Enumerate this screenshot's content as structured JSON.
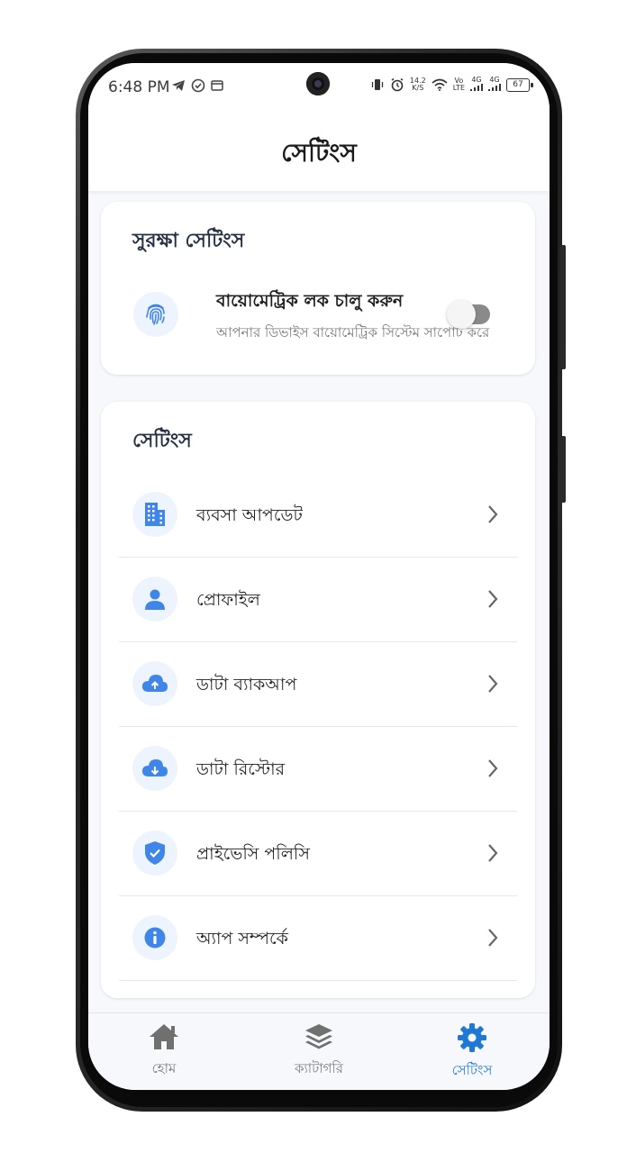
{
  "status_bar": {
    "time": "6:48 PM",
    "speed_top": "14.2",
    "speed_bottom": "K/S",
    "vo": "Vo",
    "lte": "LTE",
    "net1": "4G",
    "net2": "4G",
    "battery": "67"
  },
  "app_bar": {
    "title": "সেটিংস"
  },
  "security_card": {
    "title": "সুরক্ষা সেটিংস",
    "biometric": {
      "title": "বায়োমেট্রিক লক চালু করুন",
      "subtitle": "আপনার ডিভাইস বায়োমেট্রিক সিস্টেম সাপোর্ট করে",
      "enabled": false
    }
  },
  "settings_card": {
    "title": "সেটিংস",
    "items": [
      {
        "label": "ব্যবসা আপডেট",
        "icon": "building-icon"
      },
      {
        "label": "প্রোফাইল",
        "icon": "person-icon"
      },
      {
        "label": "ডাটা ব্যাকআপ",
        "icon": "cloud-upload-icon"
      },
      {
        "label": "ডাটা রিস্টোর",
        "icon": "cloud-download-icon"
      },
      {
        "label": "প্রাইভেসি পলিসি",
        "icon": "shield-check-icon"
      },
      {
        "label": "অ্যাপ সম্পর্কে",
        "icon": "info-icon"
      }
    ]
  },
  "bottom_nav": {
    "home": "হোম",
    "category": "ক্যাটাগরি",
    "settings": "সেটিংস",
    "active": "settings"
  },
  "colors": {
    "accent": "#1e78d4",
    "icon_blue": "#3f86e8",
    "icon_bg": "#eef4fd"
  }
}
